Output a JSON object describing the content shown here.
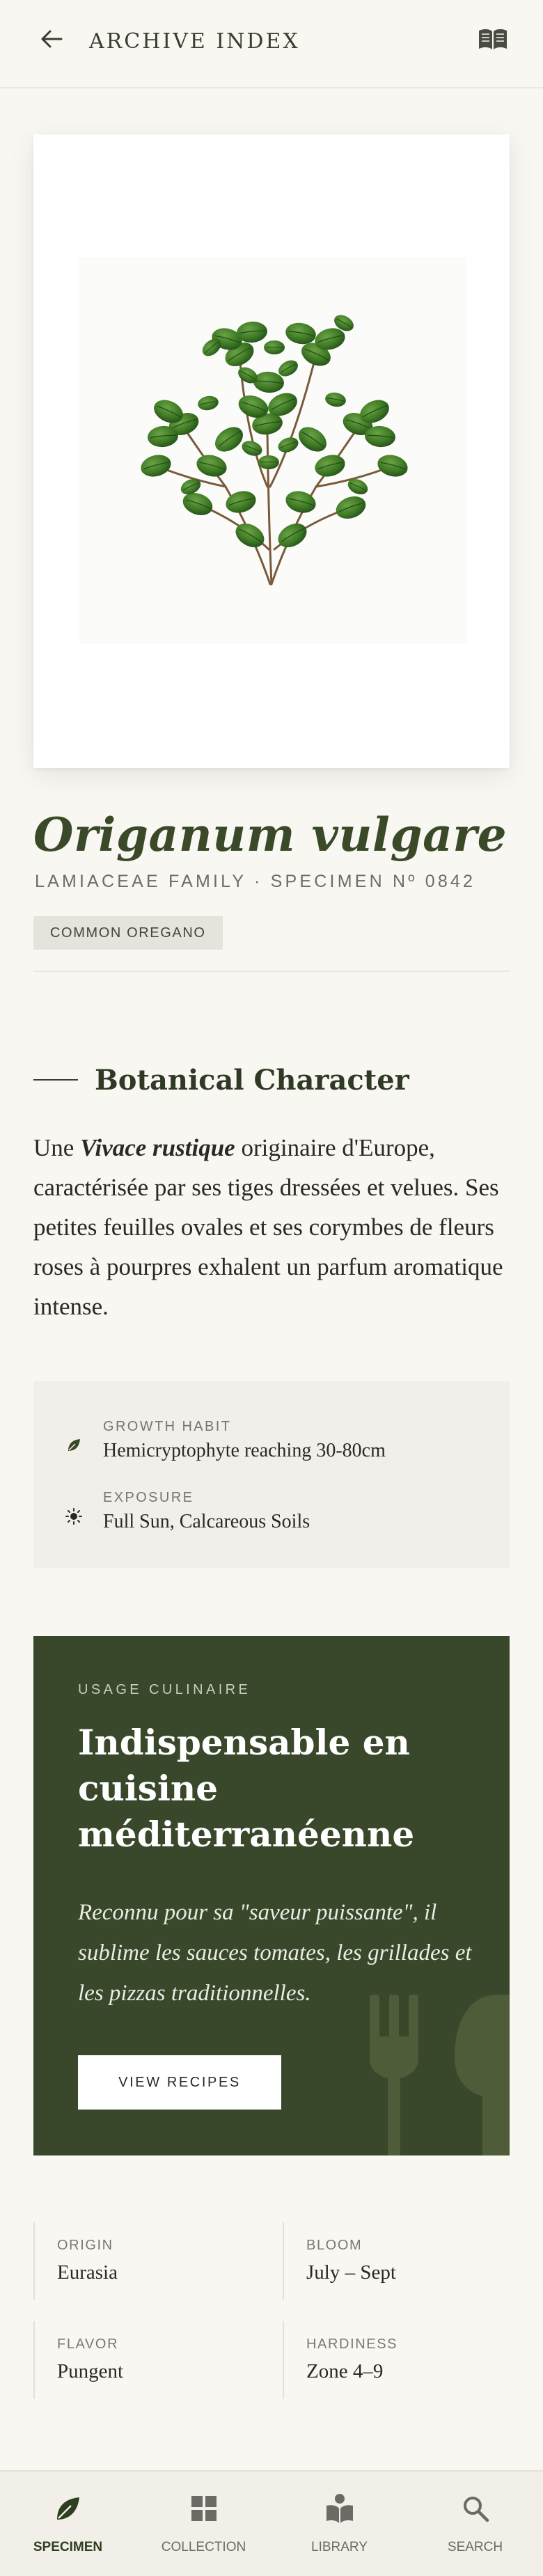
{
  "header": {
    "title": "ARCHIVE INDEX",
    "back_icon": "arrow-left-icon",
    "menu_icon": "open-book-icon"
  },
  "specimen": {
    "image_alt": "oregano-plant-illustration",
    "name": "Origanum vulgare",
    "family_line": "LAMIACEAE FAMILY · SPECIMEN Nº 0842",
    "common_name": "COMMON OREGANO"
  },
  "botanical": {
    "heading": "Botanical Character",
    "desc_lead": "Une ",
    "desc_emph": "Vivace rustique",
    "desc_rest": " originaire d'Europe, caractérisée par ses tiges dressées et velues. Ses petites feuilles ovales et ses corymbes de fleurs roses à pourpres exhalent un parfum aromatique intense."
  },
  "facts": [
    {
      "icon": "leaf-icon",
      "label": "GROWTH HABIT",
      "value": "Hemicryptophyte reaching 30-80cm"
    },
    {
      "icon": "sun-icon",
      "label": "EXPOSURE",
      "value": "Full Sun, Calcareous Soils"
    }
  ],
  "culinary": {
    "eyebrow": "USAGE CULINAIRE",
    "title": "Indispensable en cuisine méditerranéenne",
    "text": "Reconnu pour sa \"saveur puissante\", il sublime les sauces tomates, les grillades et les pizzas traditionnelles.",
    "button_label": "VIEW RECIPES",
    "deco_icon": "fork-spoon-icon"
  },
  "stats": [
    {
      "label": "ORIGIN",
      "value": "Eurasia"
    },
    {
      "label": "BLOOM",
      "value": "July – Sept"
    },
    {
      "label": "FLAVOR",
      "value": "Pungent"
    },
    {
      "label": "HARDINESS",
      "value": "Zone 4–9"
    }
  ],
  "nav": [
    {
      "label": "SPECIMEN",
      "icon": "leaf-icon",
      "active": true
    },
    {
      "label": "COLLECTION",
      "icon": "grid-icon",
      "active": false
    },
    {
      "label": "LIBRARY",
      "icon": "reader-icon",
      "active": false
    },
    {
      "label": "SEARCH",
      "icon": "search-icon",
      "active": false
    }
  ],
  "colors": {
    "background": "#f9f7f2",
    "brand_green": "#39472a",
    "title_green": "#3a4a28"
  }
}
